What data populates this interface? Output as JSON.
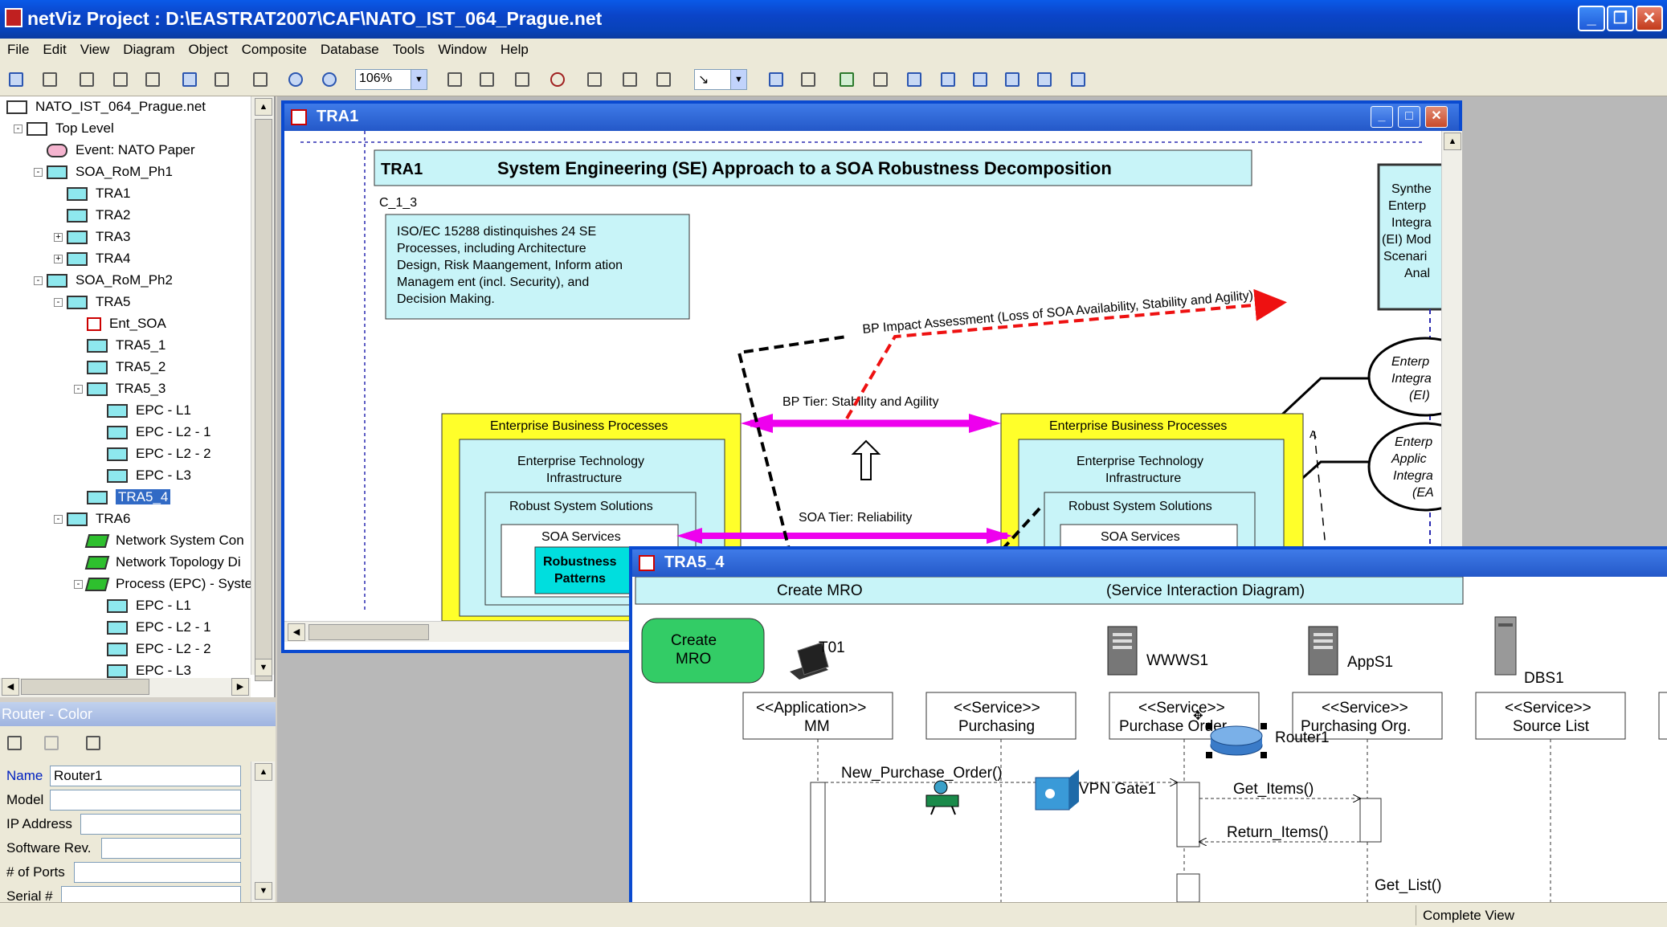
{
  "window": {
    "title": "netViz Project : D:\\EASTRAT2007\\CAF\\NATO_IST_064_Prague.net",
    "min": "_",
    "max": "❐",
    "close": "✕"
  },
  "menu": [
    "File",
    "Edit",
    "View",
    "Diagram",
    "Object",
    "Composite",
    "Database",
    "Tools",
    "Window",
    "Help"
  ],
  "toolbar": {
    "zoom": "106%"
  },
  "tree": {
    "items": [
      {
        "label": "NATO_IST_064_Prague.net",
        "icon": "file-icon",
        "level": 0
      },
      {
        "label": "Top Level",
        "icon": "layers-icon",
        "level": 1,
        "expander": "-"
      },
      {
        "label": "Event: NATO Paper",
        "icon": "event-icon",
        "level": 2
      },
      {
        "label": "SOA_RoM_Ph1",
        "icon": "diagram-icon",
        "level": 2,
        "expander": "-"
      },
      {
        "label": "TRA1",
        "icon": "diagram-icon",
        "level": 3
      },
      {
        "label": "TRA2",
        "icon": "diagram-icon",
        "level": 3
      },
      {
        "label": "TRA3",
        "icon": "diagram-icon",
        "level": 3,
        "expander": "+"
      },
      {
        "label": "TRA4",
        "icon": "diagram-icon",
        "level": 3,
        "expander": "+"
      },
      {
        "label": "SOA_RoM_Ph2",
        "icon": "diagram-icon",
        "level": 2,
        "expander": "-"
      },
      {
        "label": "TRA5",
        "icon": "diagram-icon",
        "level": 3,
        "expander": "-"
      },
      {
        "label": "Ent_SOA",
        "icon": "soa-icon",
        "level": 4
      },
      {
        "label": "TRA5_1",
        "icon": "diagram-icon",
        "level": 4
      },
      {
        "label": "TRA5_2",
        "icon": "diagram-icon",
        "level": 4
      },
      {
        "label": "TRA5_3",
        "icon": "diagram-icon",
        "level": 4,
        "expander": "-"
      },
      {
        "label": "EPC - L1",
        "icon": "diagram-icon",
        "level": 5
      },
      {
        "label": "EPC - L2 - 1",
        "icon": "diagram-icon",
        "level": 5
      },
      {
        "label": "EPC - L2 - 2",
        "icon": "diagram-icon",
        "level": 5
      },
      {
        "label": "EPC - L3",
        "icon": "diagram-icon",
        "level": 5
      },
      {
        "label": "TRA5_4",
        "icon": "diagram-icon",
        "level": 4,
        "selected": true
      },
      {
        "label": "TRA6",
        "icon": "diagram-icon",
        "level": 3,
        "expander": "-"
      },
      {
        "label": "Network System Con",
        "icon": "green-diagram-icon",
        "level": 4
      },
      {
        "label": "Network Topology Di",
        "icon": "green-diagram-icon",
        "level": 4
      },
      {
        "label": "Process (EPC) - Syste",
        "icon": "green-diagram-icon",
        "level": 4,
        "expander": "-"
      },
      {
        "label": "EPC - L1",
        "icon": "diagram-icon",
        "level": 5
      },
      {
        "label": "EPC - L2 - 1",
        "icon": "diagram-icon",
        "level": 5
      },
      {
        "label": "EPC - L2 - 2",
        "icon": "diagram-icon",
        "level": 5
      },
      {
        "label": "EPC - L3",
        "icon": "diagram-icon",
        "level": 5
      }
    ]
  },
  "properties": {
    "title": "Router - Color",
    "fields": [
      {
        "label": "Name",
        "value": "Router1"
      },
      {
        "label": "Model",
        "value": ""
      },
      {
        "label": "IP Address",
        "value": ""
      },
      {
        "label": "Software Rev.",
        "value": ""
      },
      {
        "label": "# of Ports",
        "value": ""
      },
      {
        "label": "Serial #",
        "value": ""
      }
    ]
  },
  "tra1": {
    "window_title": "TRA1",
    "header_id": "TRA1",
    "header_title": "System Engineering (SE) Approach to a SOA Robustness Decomposition",
    "code": "C_1_3",
    "note": [
      "ISO/EC 15288 distinquishes 24 SE",
      "Processes, including Architecture",
      "Design, Risk Maangement, Inform ation",
      "Managem ent (incl. Security), and",
      "Decision Making."
    ],
    "impact_label": "BP Impact Assessment (Loss of SOA Availability, Stability and Agility)",
    "bp_tier": "BP Tier: Stability and Agility",
    "soa_tier": "SOA Tier: Reliability",
    "ebp": "Enterprise Business Processes",
    "eti": [
      "Enterprise Technology",
      "Infrastructure"
    ],
    "rss": "Robust System Solutions",
    "soa": "SOA Services",
    "patterns": [
      "Robustness",
      "Patterns"
    ],
    "side_box": [
      "Synthe",
      "Enterp",
      "Integra",
      "(EI) Mod",
      "Scenari",
      "Anal"
    ],
    "ellipse1": [
      "Enterp",
      "Integra",
      "(EI)"
    ],
    "ellipse2": [
      "Enterp",
      "Applic",
      "Integra",
      "(EA"
    ]
  },
  "tra54": {
    "window_title": "TRA5_4",
    "header_left": "Create MRO",
    "header_right": "(Service Interaction Diagram)",
    "start_node": [
      "Create",
      "MRO"
    ],
    "devices": [
      "T01",
      "WWWS1",
      "AppS1",
      "DBS1",
      "Router1",
      "VPN Gate1"
    ],
    "lifelines": [
      [
        "<<Application>>",
        "MM"
      ],
      [
        "<<Service>>",
        "Purchasing"
      ],
      [
        "<<Service>>",
        "Purchase Order"
      ],
      [
        "<<Service>>",
        "Purchasing Org."
      ],
      [
        "<<Service>>",
        "Source List"
      ]
    ],
    "messages": [
      "New_Purchase_Order()",
      "Get_Items()",
      "Return_Items()",
      "Get_List()"
    ]
  },
  "status": {
    "view": "Complete View"
  },
  "colors": {
    "titlebar": "#0b44c8",
    "diagram_cyan": "#c8f4f8",
    "yellow": "#ffff2a",
    "magenta": "#ee00ee",
    "red_dash": "#ee1111"
  }
}
